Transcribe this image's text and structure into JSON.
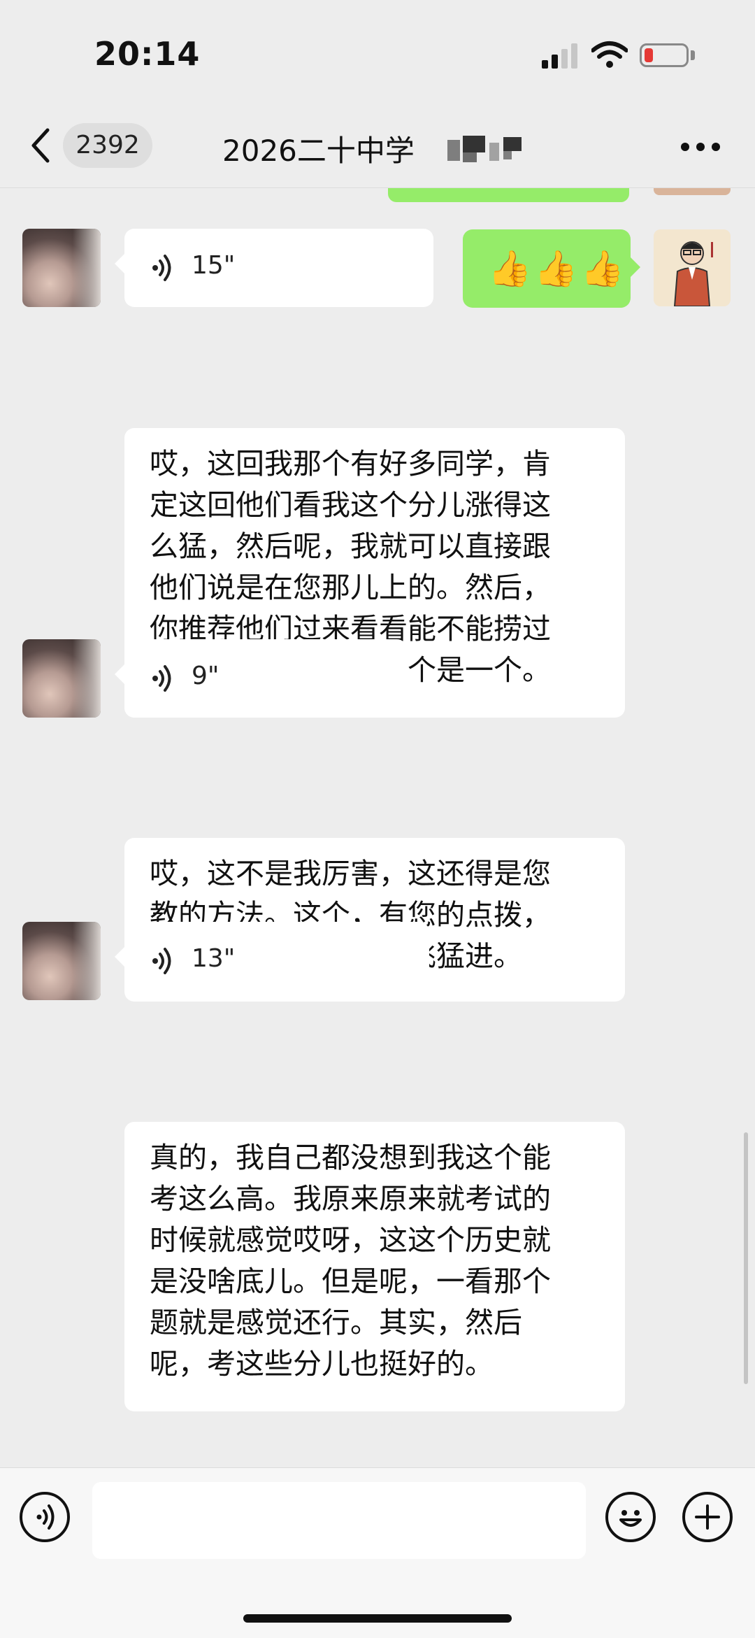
{
  "status_bar": {
    "time": "20:14"
  },
  "nav": {
    "unread_count": "2392",
    "title": "2026二十中学"
  },
  "messages": [
    {
      "sender": "self",
      "type": "emoji",
      "content": "👍👍👍"
    },
    {
      "sender": "other",
      "type": "voice",
      "duration": "15\""
    },
    {
      "sender": "other",
      "type": "text",
      "lines": [
        "哎，这回我那个有好多同学，肯",
        "定这回他们看我这个分儿涨得这",
        "么猛，然后呢，我就可以直接跟",
        "他们说是在您那儿上的。然后，",
        "你推荐他们过来看看能不能捞过",
        "来几个。能捞过来一个是一个。"
      ]
    },
    {
      "sender": "other",
      "type": "voice",
      "duration": "9\""
    },
    {
      "sender": "other",
      "type": "text",
      "lines": [
        "哎，这不是我厉害，这还得是您",
        "教的方法。这个，有您的点拨，",
        "才能让我这个分儿突飞猛进。"
      ]
    },
    {
      "sender": "other",
      "type": "voice",
      "duration": "13\""
    },
    {
      "sender": "other",
      "type": "text",
      "lines": [
        "真的，我自己都没想到我这个能",
        "考这么高。我原来原来就考试的",
        "时候就感觉哎呀，这这个历史就",
        "是没啥底儿。但是呢，一看那个",
        "题就是感觉还行。其实，然后",
        "呢，考这些分儿也挺好的。"
      ]
    }
  ],
  "input": {
    "placeholder": ""
  },
  "colors": {
    "self_bubble": "#95ec69",
    "background": "#ededed",
    "other_bubble": "#ffffff"
  },
  "icons": [
    "back-icon",
    "more-icon",
    "voice-icon",
    "voice-mode-icon",
    "emoji-icon",
    "plus-icon"
  ]
}
